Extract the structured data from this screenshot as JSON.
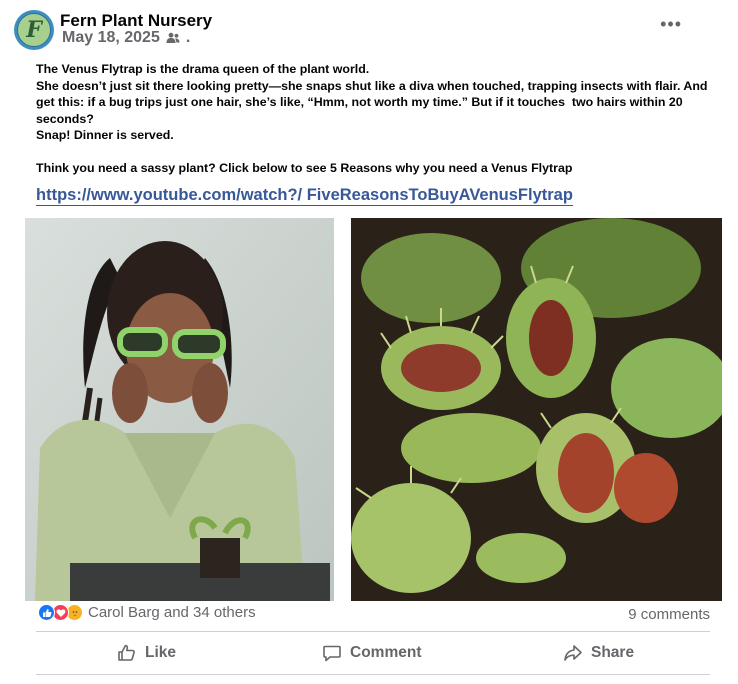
{
  "post": {
    "page_name": "Fern Plant Nursery",
    "avatar_letter": "F",
    "date": "May 18, 2025",
    "meta_dot": ".",
    "more_label": "•••",
    "text_lines": [
      "The Venus Flytrap is the drama queen of the plant world.",
      "She doesn’t just sit there looking pretty—she snaps shut like a diva when touched, trapping insects with flair. And get this: if a bug trips just one hair, she’s like, “Hmm, not worth my time.” But if it touches  two hairs within 20 seconds?",
      "Snap! Dinner is served."
    ],
    "cta_text": "Think you need a sassy plant? Click below to see 5 Reasons why you need a Venus Flytrap",
    "link": "https://www.youtube.com/watch?/ FiveReasonsToBuyAVenusFlytrap"
  },
  "engagement": {
    "reactions_label": "Carol Barg and 34 others",
    "comments_label": "9 comments",
    "reaction_icons": [
      "like-icon",
      "love-icon",
      "care-icon"
    ]
  },
  "actions": {
    "like": "Like",
    "comment": "Comment",
    "share": "Share"
  },
  "colors": {
    "link": "#385898",
    "secondary_text": "#65676b",
    "like_blue": "#1877f2",
    "love_red": "#f33e58",
    "care_yellow": "#f7b125"
  }
}
